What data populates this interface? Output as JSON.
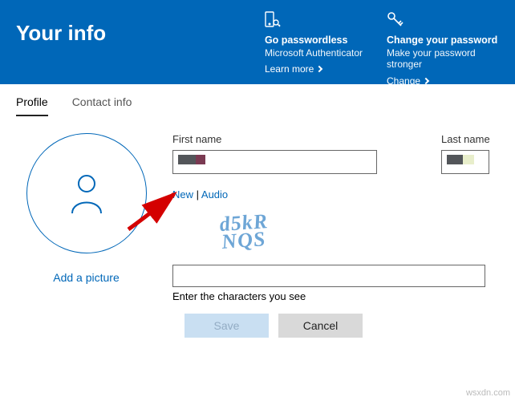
{
  "header": {
    "title": "Your info",
    "card1": {
      "title": "Go passwordless",
      "sub": "Microsoft Authenticator",
      "link": "Learn more"
    },
    "card2": {
      "title": "Change your password",
      "sub": "Make your password stronger",
      "link": "Change"
    }
  },
  "tabs": {
    "t1": "Profile",
    "t2": "Contact info"
  },
  "avatar": {
    "add": "Add a picture"
  },
  "form": {
    "first_name_label": "First name",
    "last_name_label": "Last name"
  },
  "captcha": {
    "new": "New",
    "sep": " | ",
    "audio": "Audio",
    "text": "d5kR\nNQS",
    "caption": "Enter the characters you see"
  },
  "buttons": {
    "save": "Save",
    "cancel": "Cancel"
  },
  "watermark": "wsxdn.com"
}
